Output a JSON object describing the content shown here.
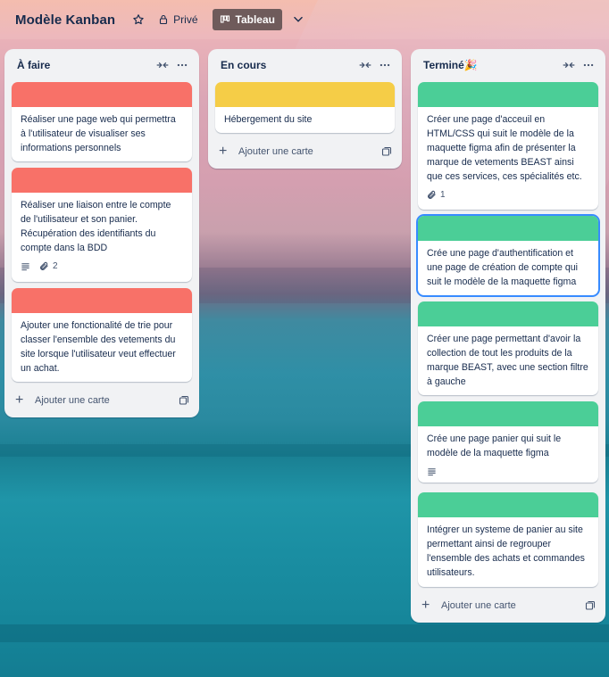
{
  "board": {
    "title": "Modèle Kanban",
    "visibility_label": "Privé",
    "view_label": "Tableau"
  },
  "colors": {
    "red_cover": "#f87168",
    "yellow_cover": "#f5cd47",
    "green_cover": "#4bce97",
    "list_bg": "#f1f2f4",
    "text": "#172b4d"
  },
  "icons": {
    "star": "star-icon",
    "lock": "lock-icon",
    "board": "board-icon",
    "chevron": "chevron-down-icon",
    "collapse": "collapse-icon",
    "more": "more-icon",
    "description": "description-icon",
    "attachment": "paperclip-icon",
    "plus": "plus-icon",
    "template": "template-icon"
  },
  "lists": [
    {
      "title": "À faire",
      "add_label": "Ajouter une carte",
      "cards": [
        {
          "text": "Réaliser une page web qui permettra à l'utilisateur de visualiser ses informations personnels",
          "cover": "red"
        },
        {
          "text": "Réaliser une liaison entre le compte de l'utilisateur et son panier. Récupération des identifiants du compte dans la BDD",
          "cover": "red",
          "attachments": "2"
        },
        {
          "text": "Ajouter une fonctionalité de trie pour classer l'ensemble des vetements du site lorsque l'utilisateur veut effectuer un achat.",
          "cover": "red"
        }
      ]
    },
    {
      "title": "En cours",
      "add_label": "Ajouter une carte",
      "cards": [
        {
          "text": "Hébergement du site",
          "cover": "yellow"
        }
      ]
    },
    {
      "title": "Terminé🎉",
      "add_label": "Ajouter une carte",
      "cards": [
        {
          "text": "Créer une page d'acceuil en HTML/CSS qui suit le modèle de la maquette figma afin de présenter la marque de vetements BEAST ainsi que ces services, ces spécialités etc.",
          "cover": "green",
          "attachments": "1"
        },
        {
          "text": "Crée une page d'authentification et une page de création de compte qui suit le modèle de la maquette figma",
          "cover": "green"
        },
        {
          "text": "Créer une page permettant d'avoir la collection de tout les produits de la marque BEAST, avec une section filtre à gauche",
          "cover": "green"
        },
        {
          "text": "Crée une page panier qui suit le modèle de la maquette figma",
          "cover": "green"
        },
        {
          "text": "Intégrer un systeme de panier au site permettant ainsi de regrouper l'ensemble des achats et commandes utilisateurs.",
          "cover": "green"
        }
      ]
    }
  ]
}
